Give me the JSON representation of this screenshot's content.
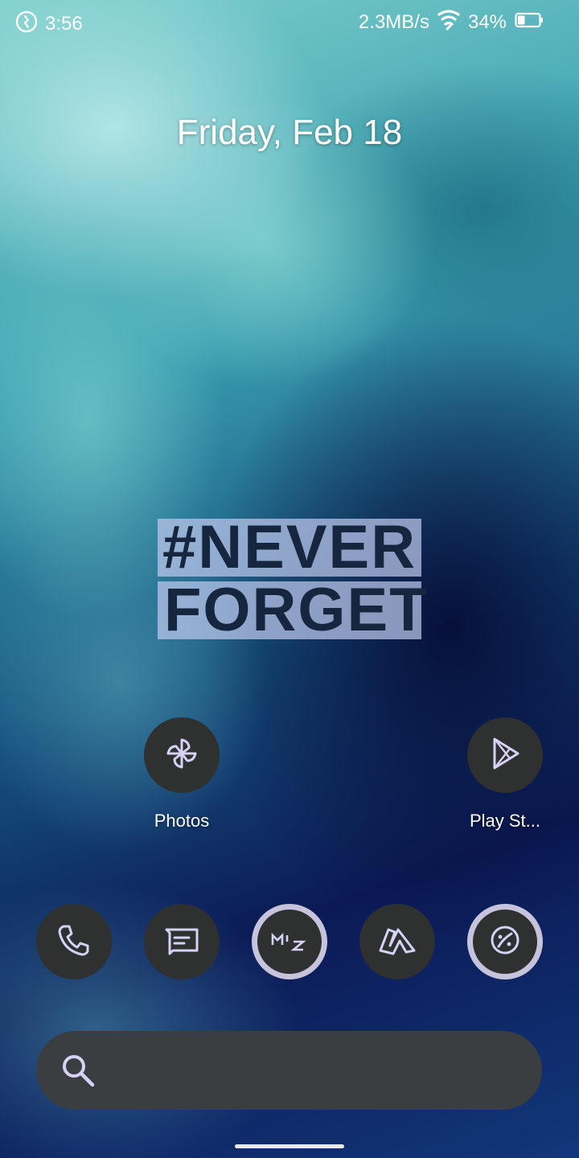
{
  "status_bar": {
    "time": "3:56",
    "net_speed": "2.3MB/s",
    "battery": "34%",
    "battery_level": 0.34
  },
  "date": "Friday, Feb 18",
  "wallpaper_text": {
    "line1": "#NEVER",
    "line2": "FORGET"
  },
  "apps": [
    {
      "label": "Photos",
      "icon": "photos-pinwheel-icon"
    },
    {
      "label": "Play St...",
      "icon": "play-store-icon"
    }
  ],
  "dock": [
    {
      "name": "phone",
      "icon": "phone-icon"
    },
    {
      "name": "messages",
      "icon": "messages-icon"
    },
    {
      "name": "mix-app",
      "icon": "mix-icon"
    },
    {
      "name": "launcher-app",
      "icon": "letter-n-icon"
    },
    {
      "name": "theme-app",
      "icon": "palette-icon"
    }
  ],
  "search": {
    "icon": "search-icon"
  },
  "colors": {
    "icon_bg": "#2f3030",
    "icon_glyph": "#d7d1f5",
    "ring": "#c7c3dc",
    "search_bg": "#3b3e40"
  }
}
